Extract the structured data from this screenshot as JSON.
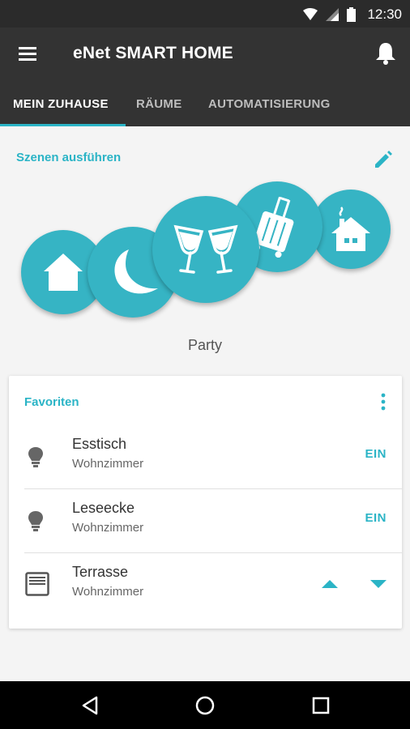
{
  "status_bar": {
    "time": "12:30",
    "icons": [
      "wifi-icon",
      "signal-icon",
      "battery-icon"
    ]
  },
  "app_bar": {
    "menu_icon": "menu-icon",
    "title": "eNet SMART HOME",
    "notification_icon": "bell-icon"
  },
  "tabs": [
    {
      "label": "MEIN ZUHAUSE",
      "active": true
    },
    {
      "label": "RÄUME",
      "active": false
    },
    {
      "label": "AUTOMATISIERUNG",
      "active": false
    }
  ],
  "scenes": {
    "title": "Szenen ausführen",
    "edit_icon": "pencil-icon",
    "selected_label": "Party",
    "items": [
      {
        "icon": "home-icon"
      },
      {
        "icon": "moon-icon"
      },
      {
        "icon": "wine-glasses-icon"
      },
      {
        "icon": "luggage-icon"
      },
      {
        "icon": "house-chimney-icon"
      }
    ]
  },
  "favorites": {
    "title": "Favoriten",
    "more_icon": "more-vert-icon",
    "items": [
      {
        "name": "Esstisch",
        "room": "Wohnzimmer",
        "action": "EIN",
        "icon": "lightbulb-icon"
      },
      {
        "name": "Leseecke",
        "room": "Wohnzimmer",
        "action": "EIN",
        "icon": "lightbulb-icon"
      },
      {
        "name": "Terrasse",
        "room": "Wohnzimmer",
        "icon": "blind-icon",
        "controls": [
          "up-arrow",
          "down-arrow"
        ]
      }
    ]
  },
  "nav_bar": {
    "icons": [
      "back-icon",
      "home-circle-icon",
      "recents-icon"
    ]
  },
  "colors": {
    "accent": "#2bb4c6",
    "app_bar": "#333333",
    "status_bar": "#2b2b2b",
    "scene_circle": "#36b4c4"
  }
}
